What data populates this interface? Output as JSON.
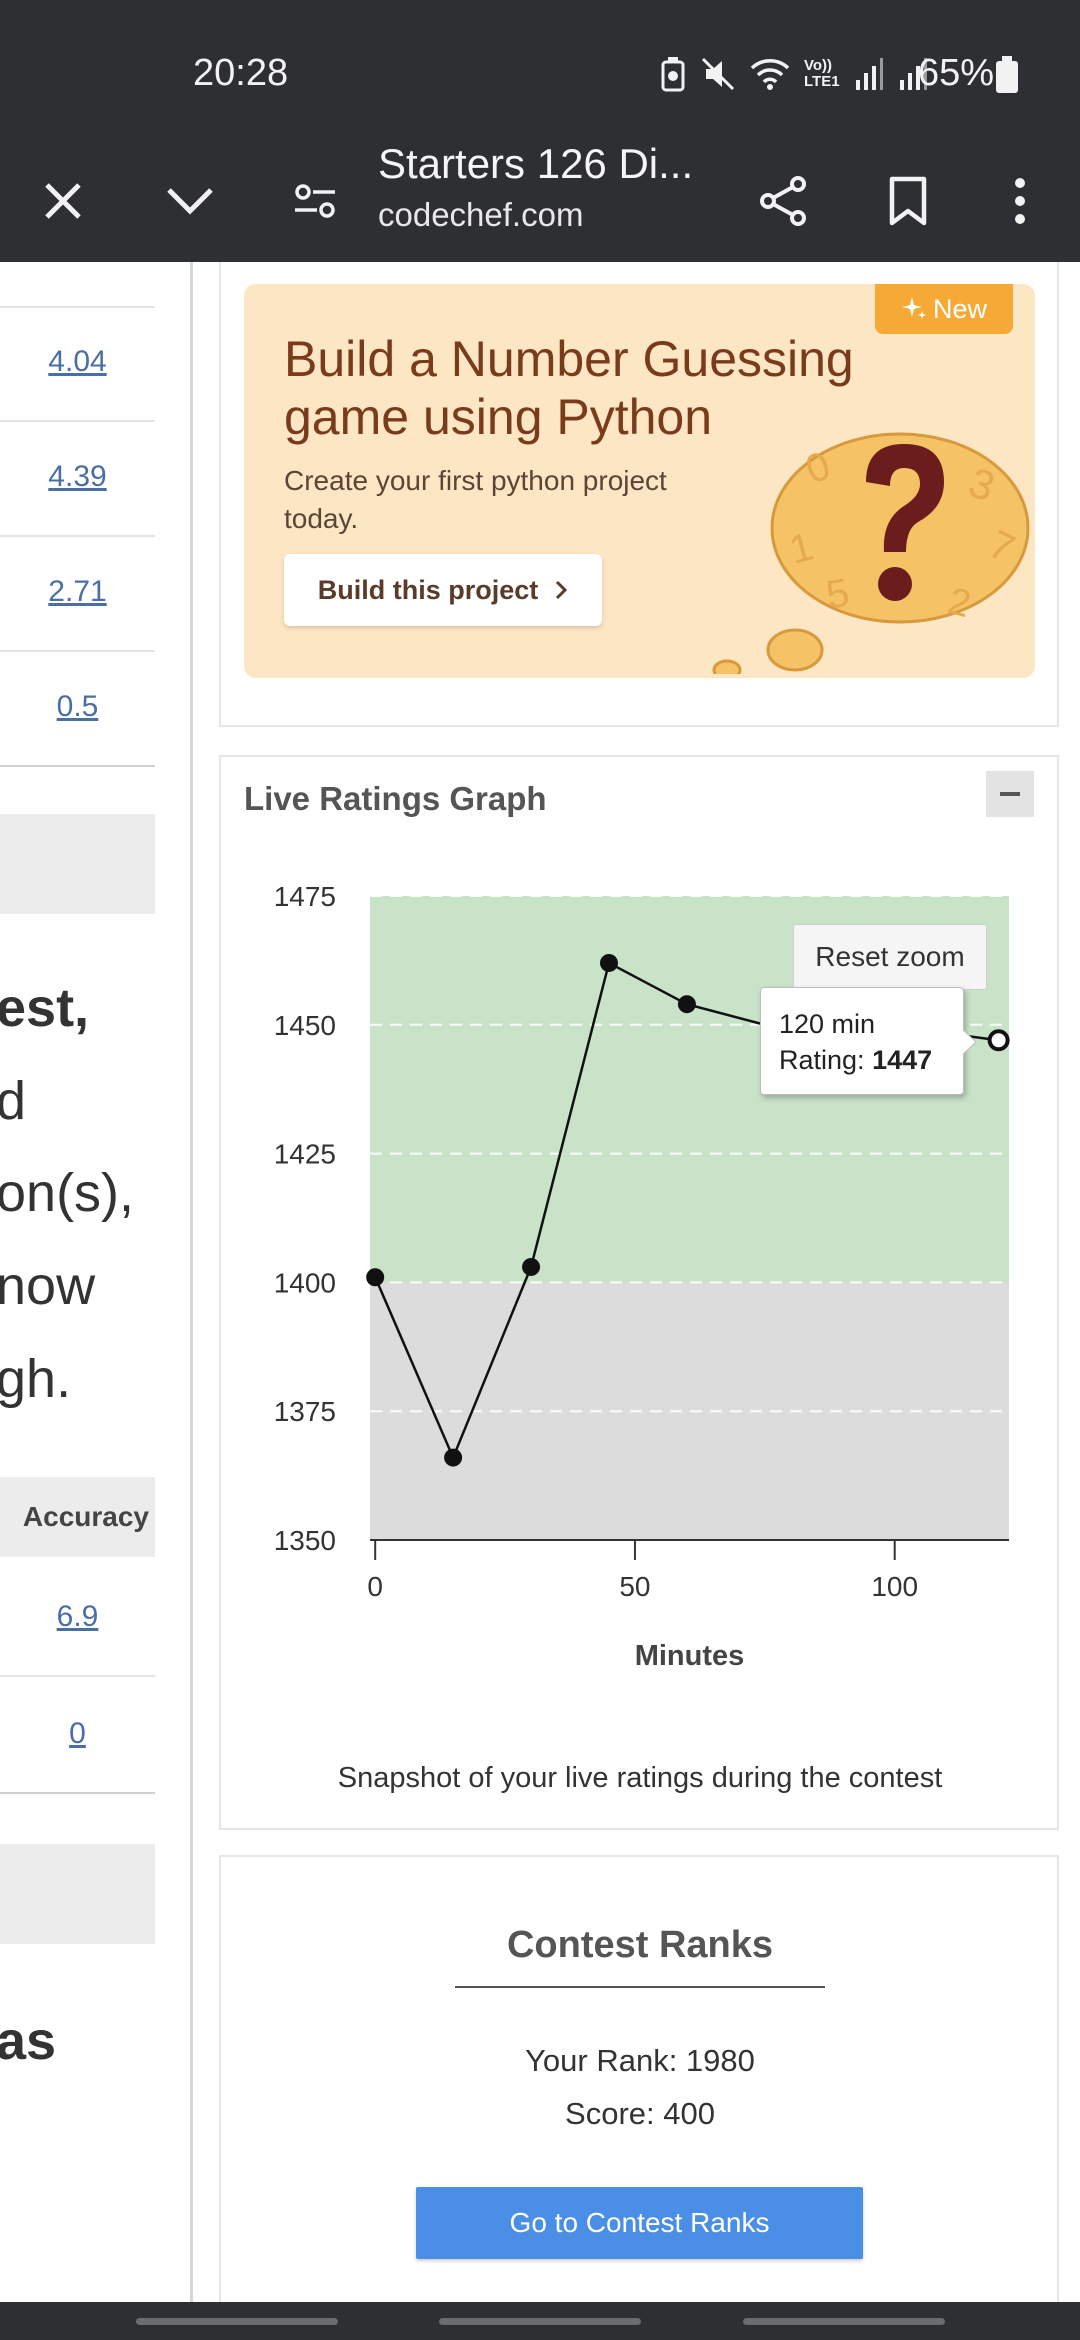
{
  "status_bar": {
    "time": "20:28",
    "signal_label": "Vo)) LTE1",
    "battery": "65%"
  },
  "browser": {
    "tab_title": "Starters 126 Di...",
    "url": "codechef.com"
  },
  "left_panel": {
    "values": [
      "4.04",
      "4.39",
      "2.71",
      "0.5"
    ],
    "text_fragments": [
      "est,",
      "d",
      "on(s),",
      "now",
      "gh."
    ],
    "column_header": "Accuracy",
    "accuracy_values": [
      "6.9",
      "0"
    ],
    "bottom_fragment": "as"
  },
  "promo": {
    "badge": "New",
    "title": "Build a Number Guessing game using Python",
    "subtitle": "Create your first python project today.",
    "button_label": "Build this project",
    "accent": "#f7a935"
  },
  "graph_card": {
    "title": "Live Ratings Graph",
    "caption": "Snapshot of your live ratings during the contest",
    "reset_zoom": "Reset zoom",
    "tooltip": {
      "line1": "120 min",
      "label": "Rating: ",
      "value": "1447"
    }
  },
  "chart_data": {
    "type": "line",
    "xlabel": "Minutes",
    "ylabel": "",
    "xlim": [
      -1,
      122
    ],
    "ylim": [
      1350,
      1475
    ],
    "x_ticks": [
      0,
      50,
      100
    ],
    "y_ticks": [
      1350,
      1375,
      1400,
      1425,
      1450,
      1475
    ],
    "bands": [
      {
        "from": 1400,
        "to": 1475,
        "color": "#c9e3c9"
      },
      {
        "from": 1350,
        "to": 1400,
        "color": "#dcdcdc"
      }
    ],
    "series": [
      {
        "x": [
          0,
          15,
          30,
          45,
          60,
          75,
          90,
          105,
          120
        ],
        "y": [
          1401,
          1366,
          1403,
          1462,
          1454,
          1450,
          1448,
          1449,
          1447
        ]
      }
    ],
    "hidden_points": [
      5,
      6,
      7
    ],
    "highlight_index": 8,
    "grid": true
  },
  "ranks": {
    "title": "Contest Ranks",
    "rank_line": "Your Rank: 1980",
    "score_line": "Score: 400",
    "button_label": "Go to Contest Ranks",
    "button_color": "#4a8ee6"
  }
}
